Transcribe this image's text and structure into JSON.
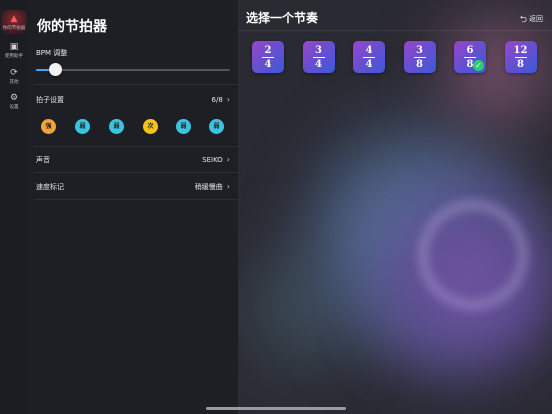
{
  "rail": {
    "items": [
      {
        "label": "你的节拍器",
        "icon": "metronome-icon",
        "active": true
      },
      {
        "label": "使用助手",
        "icon": "assistant-icon",
        "active": false
      },
      {
        "label": "其他",
        "icon": "other-icon",
        "active": false
      },
      {
        "label": "设置",
        "icon": "gear-icon",
        "active": false
      }
    ]
  },
  "panel": {
    "title": "你的节拍器",
    "bpm": {
      "label": "BPM 调整",
      "level": 0.1
    },
    "beat_settings": {
      "label": "拍子设置",
      "value": "6/8"
    },
    "beats": [
      {
        "label": "强",
        "color": "#f2a33a"
      },
      {
        "label": "弱",
        "color": "#3cc3df"
      },
      {
        "label": "弱",
        "color": "#3cc3df"
      },
      {
        "label": "次",
        "color": "#f2c31a"
      },
      {
        "label": "弱",
        "color": "#3cc3df"
      },
      {
        "label": "弱",
        "color": "#3cc3df"
      }
    ],
    "sound": {
      "label": "声音",
      "value": "SEIKO"
    },
    "tempo": {
      "label": "速度标记",
      "value": "稍缓慢曲"
    }
  },
  "header": {
    "title": "选择一个节奏",
    "back_label": "返回"
  },
  "rhythms": [
    {
      "numerator": "2",
      "denominator": "4",
      "selected": false
    },
    {
      "numerator": "3",
      "denominator": "4",
      "selected": false
    },
    {
      "numerator": "4",
      "denominator": "4",
      "selected": false
    },
    {
      "numerator": "3",
      "denominator": "8",
      "selected": false
    },
    {
      "numerator": "6",
      "denominator": "8",
      "selected": true
    },
    {
      "numerator": "12",
      "denominator": "8",
      "selected": false
    }
  ]
}
